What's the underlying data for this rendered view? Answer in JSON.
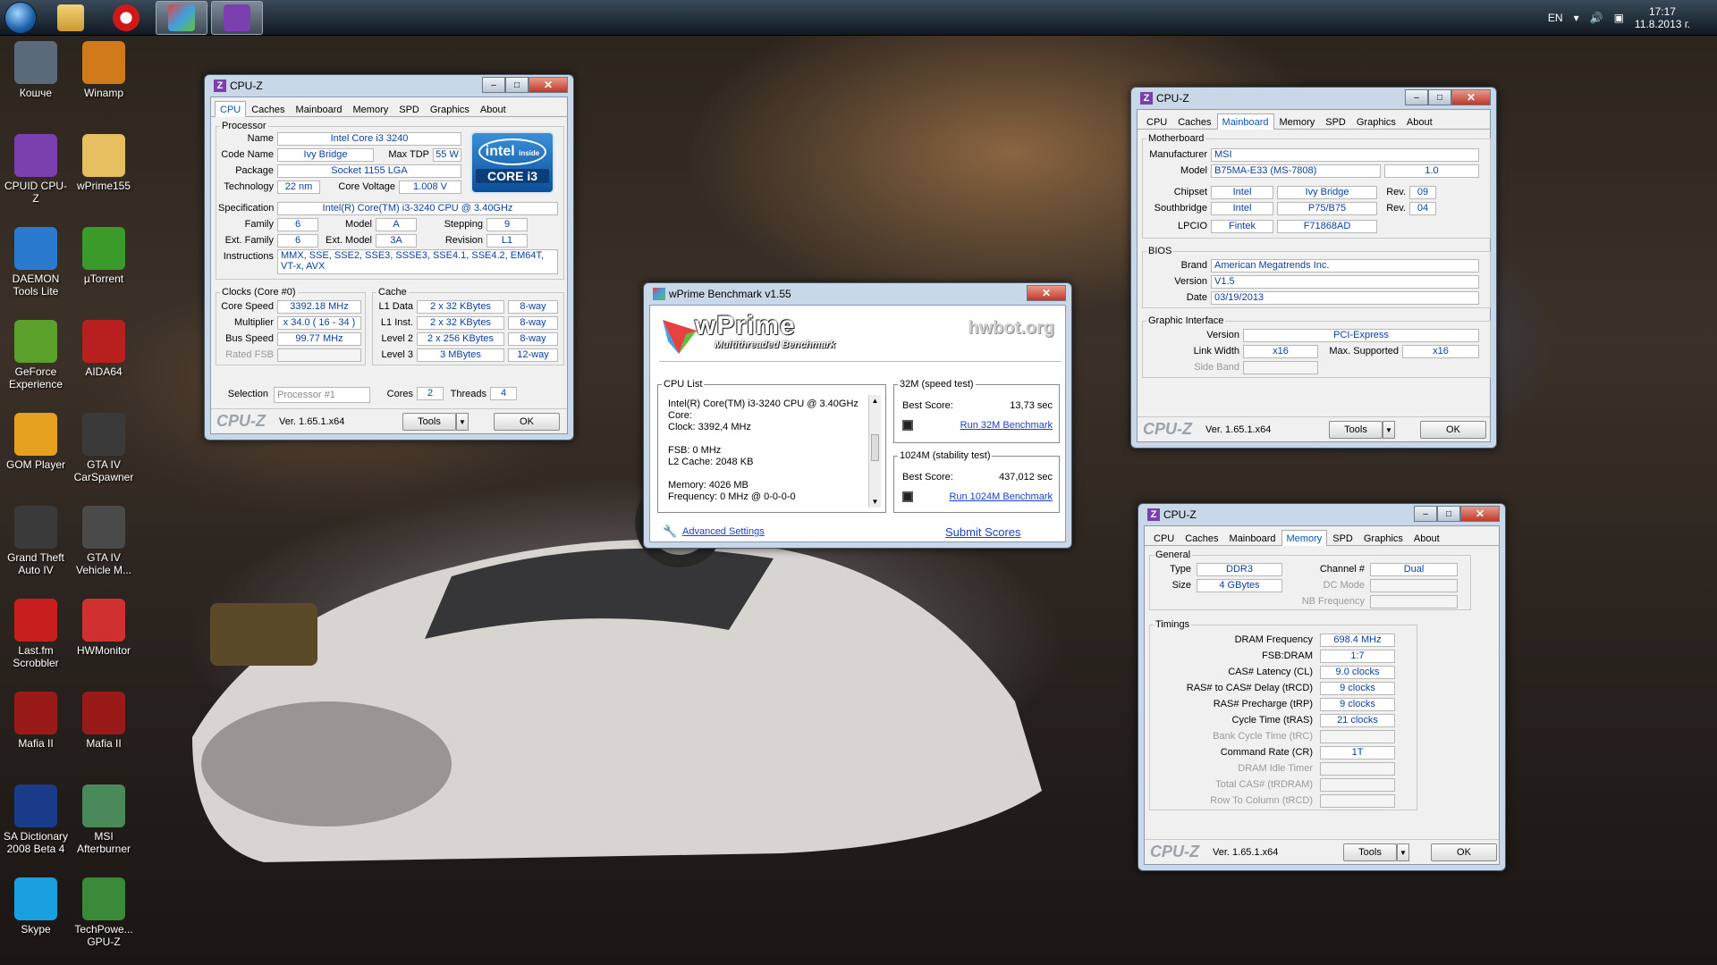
{
  "taskbar": {
    "lang": "EN",
    "time": "17:17",
    "date": "11.8.2013 г."
  },
  "desktop": {
    "icons": [
      {
        "label": "Кошче",
        "icon": "recycle-bin-icon",
        "color": "#5a6a7a"
      },
      {
        "label": "Winamp",
        "icon": "winamp-icon",
        "color": "#d07a1a"
      },
      {
        "label": "CPUID CPU-Z",
        "icon": "cpuz-icon",
        "color": "#7b3fb0"
      },
      {
        "label": "wPrime155",
        "icon": "folder-icon",
        "color": "#e6c060"
      },
      {
        "label": "DAEMON Tools Lite",
        "icon": "daemon-tools-icon",
        "color": "#2a7ad0"
      },
      {
        "label": "µTorrent",
        "icon": "utorrent-icon",
        "color": "#3a9a2a"
      },
      {
        "label": "GeForce Experience",
        "icon": "geforce-icon",
        "color": "#5aa02a"
      },
      {
        "label": "AIDA64",
        "icon": "aida64-icon",
        "color": "#b82020"
      },
      {
        "label": "GOM Player",
        "icon": "gom-player-icon",
        "color": "#e8a020"
      },
      {
        "label": "GTA IV CarSpawner",
        "icon": "gta-iv-icon",
        "color": "#3a3a3a"
      },
      {
        "label": "Grand Theft Auto IV",
        "icon": "gta-iv-icon",
        "color": "#3a3a3a"
      },
      {
        "label": "GTA IV Vehicle M...",
        "icon": "vehicle-tool-icon",
        "color": "#4a4a4a"
      },
      {
        "label": "Last.fm Scrobbler",
        "icon": "lastfm-icon",
        "color": "#c81e1e"
      },
      {
        "label": "HWMonitor",
        "icon": "hwmonitor-icon",
        "color": "#d03030"
      },
      {
        "label": "Mafia II",
        "icon": "mafia-icon",
        "color": "#9a1a1a"
      },
      {
        "label": "Mafia II",
        "icon": "mafia-icon",
        "color": "#9a1a1a"
      },
      {
        "label": "SA Dictionary 2008 Beta 4",
        "icon": "uk-flag-icon",
        "color": "#1a3a8a"
      },
      {
        "label": "MSI Afterburner",
        "icon": "afterburner-icon",
        "color": "#4a8a5a"
      },
      {
        "label": "Skype",
        "icon": "skype-icon",
        "color": "#18a0e0"
      },
      {
        "label": "TechPowe... GPU-Z",
        "icon": "gpuz-icon",
        "color": "#3a8a3a"
      }
    ]
  },
  "cpuz1": {
    "title": "CPU-Z",
    "tabs": [
      "CPU",
      "Caches",
      "Mainboard",
      "Memory",
      "SPD",
      "Graphics",
      "About"
    ],
    "processor_legend": "Processor",
    "name_label": "Name",
    "name": "Intel Core i3 3240",
    "codename_label": "Code Name",
    "codename": "Ivy Bridge",
    "maxtdp_label": "Max TDP",
    "maxtdp": "55 W",
    "package_label": "Package",
    "package": "Socket 1155 LGA",
    "tech_label": "Technology",
    "tech": "22 nm",
    "voltage_label": "Core Voltage",
    "voltage": "1.008 V",
    "spec_label": "Specification",
    "spec": "Intel(R) Core(TM) i3-3240 CPU @ 3.40GHz",
    "family_label": "Family",
    "family": "6",
    "model_label": "Model",
    "model": "A",
    "stepping_label": "Stepping",
    "stepping": "9",
    "extfamily_label": "Ext. Family",
    "extfamily": "6",
    "extmodel_label": "Ext. Model",
    "extmodel": "3A",
    "revision_label": "Revision",
    "revision": "L1",
    "instr_label": "Instructions",
    "instr": "MMX, SSE, SSE2, SSE3, SSSE3, SSE4.1, SSE4.2, EM64T, VT-x, AVX",
    "clocks_legend": "Clocks (Core #0)",
    "corespeed_label": "Core Speed",
    "corespeed": "3392.18 MHz",
    "multiplier_label": "Multiplier",
    "multiplier": "x 34.0 ( 16 - 34 )",
    "busspeed_label": "Bus Speed",
    "busspeed": "99.77 MHz",
    "ratedfsb_label": "Rated FSB",
    "cache_legend": "Cache",
    "l1d_label": "L1 Data",
    "l1d": "2 x 32 KBytes",
    "l1d_way": "8-way",
    "l1i_label": "L1 Inst.",
    "l1i": "2 x 32 KBytes",
    "l1i_way": "8-way",
    "l2_label": "Level 2",
    "l2": "2 x 256 KBytes",
    "l2_way": "8-way",
    "l3_label": "Level 3",
    "l3": "3 MBytes",
    "l3_way": "12-way",
    "selection_label": "Selection",
    "selection": "Processor #1",
    "cores_label": "Cores",
    "cores": "2",
    "threads_label": "Threads",
    "threads": "4",
    "intel_inside": "intel",
    "intel_inside_sub": "inside",
    "intel_core": "CORE i3",
    "brand": "CPU-Z",
    "version": "Ver. 1.65.1.x64",
    "tools": "Tools",
    "ok": "OK"
  },
  "cpuz2": {
    "title": "CPU-Z",
    "tabs": [
      "CPU",
      "Caches",
      "Mainboard",
      "Memory",
      "SPD",
      "Graphics",
      "About"
    ],
    "mb_legend": "Motherboard",
    "manufacturer_label": "Manufacturer",
    "manufacturer": "MSI",
    "model_label": "Model",
    "model": "B75MA-E33 (MS-7808)",
    "model_rev": "1.0",
    "chipset_label": "Chipset",
    "chipset_vendor": "Intel",
    "chipset_name": "Ivy Bridge",
    "chipset_rev_label": "Rev.",
    "chipset_rev": "09",
    "south_label": "Southbridge",
    "south_vendor": "Intel",
    "south_name": "P75/B75",
    "south_rev_label": "Rev.",
    "south_rev": "04",
    "lpcio_label": "LPCIO",
    "lpcio_vendor": "Fintek",
    "lpcio_name": "F71868AD",
    "bios_legend": "BIOS",
    "brand_label": "Brand",
    "bios_brand": "American Megatrends Inc.",
    "version_label": "Version",
    "bios_version": "V1.5",
    "date_label": "Date",
    "bios_date": "03/19/2013",
    "gi_legend": "Graphic Interface",
    "gi_version_label": "Version",
    "gi_version": "PCI-Express",
    "linkwidth_label": "Link Width",
    "linkwidth": "x16",
    "maxsup_label": "Max. Supported",
    "maxsup": "x16",
    "sideband_label": "Side Band",
    "brand": "CPU-Z",
    "version": "Ver. 1.65.1.x64",
    "tools": "Tools",
    "ok": "OK"
  },
  "cpuz3": {
    "title": "CPU-Z",
    "tabs": [
      "CPU",
      "Caches",
      "Mainboard",
      "Memory",
      "SPD",
      "Graphics",
      "About"
    ],
    "general_legend": "General",
    "type_label": "Type",
    "type": "DDR3",
    "channel_label": "Channel #",
    "channel": "Dual",
    "dcmode_label": "DC Mode",
    "size_label": "Size",
    "size": "4 GBytes",
    "nbfreq_label": "NB Frequency",
    "timings_legend": "Timings",
    "timings": [
      {
        "label": "DRAM Frequency",
        "value": "698.4 MHz",
        "dim": false
      },
      {
        "label": "FSB:DRAM",
        "value": "1:7",
        "dim": false
      },
      {
        "label": "CAS# Latency (CL)",
        "value": "9.0 clocks",
        "dim": false
      },
      {
        "label": "RAS# to CAS# Delay (tRCD)",
        "value": "9 clocks",
        "dim": false
      },
      {
        "label": "RAS# Precharge (tRP)",
        "value": "9 clocks",
        "dim": false
      },
      {
        "label": "Cycle Time (tRAS)",
        "value": "21 clocks",
        "dim": false
      },
      {
        "label": "Bank Cycle Time (tRC)",
        "value": "",
        "dim": true
      },
      {
        "label": "Command Rate (CR)",
        "value": "1T",
        "dim": false
      },
      {
        "label": "DRAM Idle Timer",
        "value": "",
        "dim": true
      },
      {
        "label": "Total CAS# (tRDRAM)",
        "value": "",
        "dim": true
      },
      {
        "label": "Row To Column (tRCD)",
        "value": "",
        "dim": true
      }
    ],
    "brand": "CPU-Z",
    "version": "Ver. 1.65.1.x64",
    "tools": "Tools",
    "ok": "OK"
  },
  "wprime": {
    "title": "wPrime Benchmark v1.55",
    "logo": "wPrime",
    "logo_sub": "Multithreaded Benchmark",
    "hwbot": "hwbot.org",
    "cpulist_legend": "CPU List",
    "cpulist_lines": [
      "Intel(R) Core(TM) i3-3240 CPU @ 3.40GHz",
      "Core:",
      "Clock: 3392,4 MHz",
      "",
      "FSB: 0 MHz",
      "L2 Cache: 2048 KB",
      "",
      "Memory: 4026 MB",
      "Frequency: 0 MHz @ 0-0-0-0"
    ],
    "t32_legend": "32M (speed test)",
    "t32_best_label": "Best Score:",
    "t32_best": "13,73 sec",
    "t32_run": "Run 32M Benchmark",
    "t1024_legend": "1024M (stability test)",
    "t1024_best_label": "Best Score:",
    "t1024_best": "437,012 sec",
    "t1024_run": "Run 1024M Benchmark",
    "advanced": "Advanced Settings",
    "submit": "Submit Scores"
  }
}
